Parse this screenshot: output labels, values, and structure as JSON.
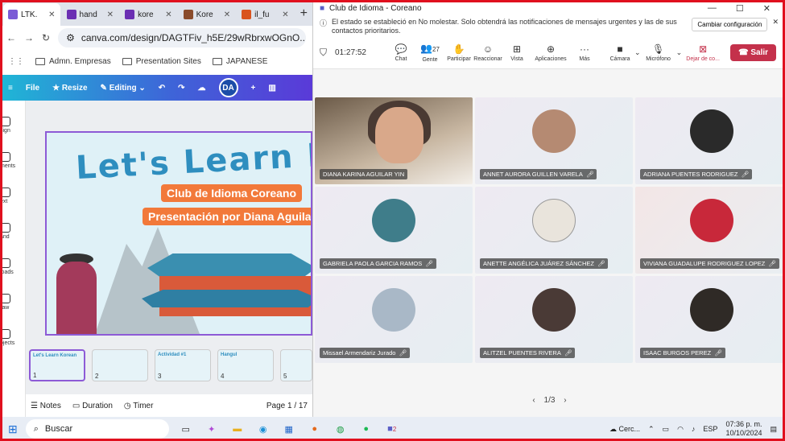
{
  "browser": {
    "tabs": [
      {
        "label": "LTK.",
        "color": "#7b5bd6",
        "active": true
      },
      {
        "label": "hand",
        "color": "#6b2fb3"
      },
      {
        "label": "kore",
        "color": "#6b2fb3"
      },
      {
        "label": "Kore",
        "color": "#8a4b2b"
      },
      {
        "label": "il_fu",
        "color": "#d9541e"
      }
    ],
    "url": "canva.com/design/DAGTFiv_h5E/29wRbrxwOGnO...",
    "bookmarks": [
      "Admn. Empresas",
      "Presentation Sites",
      "JAPANESE"
    ]
  },
  "canva": {
    "menu": {
      "file": "File",
      "resize": "Resize",
      "editing": "Editing",
      "avatar": "DA"
    },
    "side": [
      "sign",
      "ments",
      "ext",
      "and",
      "loads",
      "raw",
      "ojects"
    ],
    "slide": {
      "title": "Let's Learn Ko",
      "pill1": "Club de Idioma Coreano",
      "pill2": "Presentación por Diana Aguilar"
    },
    "thumbs": [
      {
        "num": "1",
        "text": "Let's Learn Korean"
      },
      {
        "num": "2",
        "text": ""
      },
      {
        "num": "3",
        "text": "Actividad #1"
      },
      {
        "num": "4",
        "text": "Hangul"
      },
      {
        "num": "5",
        "text": ""
      }
    ],
    "bottom": {
      "notes": "Notes",
      "duration": "Duration",
      "timer": "Timer",
      "page": "Page 1 / 17"
    }
  },
  "teams": {
    "title": "Club de Idioma - Coreano",
    "notice": "El estado se estableció en No molestar. Solo obtendrá las notificaciones de mensajes urgentes y las de sus contactos prioritarios.",
    "notice_button": "Cambiar configuración",
    "timer": "01:27:52",
    "people_count": "27",
    "toolbar": [
      "Chat",
      "Gente",
      "Participar",
      "Reaccionar",
      "Vista",
      "Aplicaciones",
      "Más",
      "Cámara",
      "Micrófono",
      "Dejar de co..."
    ],
    "leave": "Salir",
    "participants": [
      {
        "name": "DIANA KARINA AGUILAR YIN",
        "color": "#6b5a48"
      },
      {
        "name": "ANNET AURORA GUILLEN VARELA",
        "color": "#b58a72"
      },
      {
        "name": "ADRIANA PUENTES RODRIGUEZ",
        "color": "#2a2a2a"
      },
      {
        "name": "GABRIELA PAOLA GARCIA RAMOS",
        "color": "#3f7d8a"
      },
      {
        "name": "ANETTE ANGÉLICA JUÁREZ SÁNCHEZ",
        "color": "#e9e4dc"
      },
      {
        "name": "VIVIANA GUADALUPE RODRIGUEZ LOPEZ",
        "color": "#c8283a"
      },
      {
        "name": "Missael Armendariz Jurado",
        "color": "#a9b8c7"
      },
      {
        "name": "ALITZEL PUENTES RIVERA",
        "color": "#4a3a36"
      },
      {
        "name": "ISAAC BURGOS PEREZ",
        "color": "#2f2a26"
      }
    ],
    "pager": "1/3"
  },
  "taskbar": {
    "search": "Buscar",
    "weather": "Cerc...",
    "lang": "ESP",
    "time": "07:36 p. m.",
    "date": "10/10/2024",
    "teams_badge": "2"
  }
}
